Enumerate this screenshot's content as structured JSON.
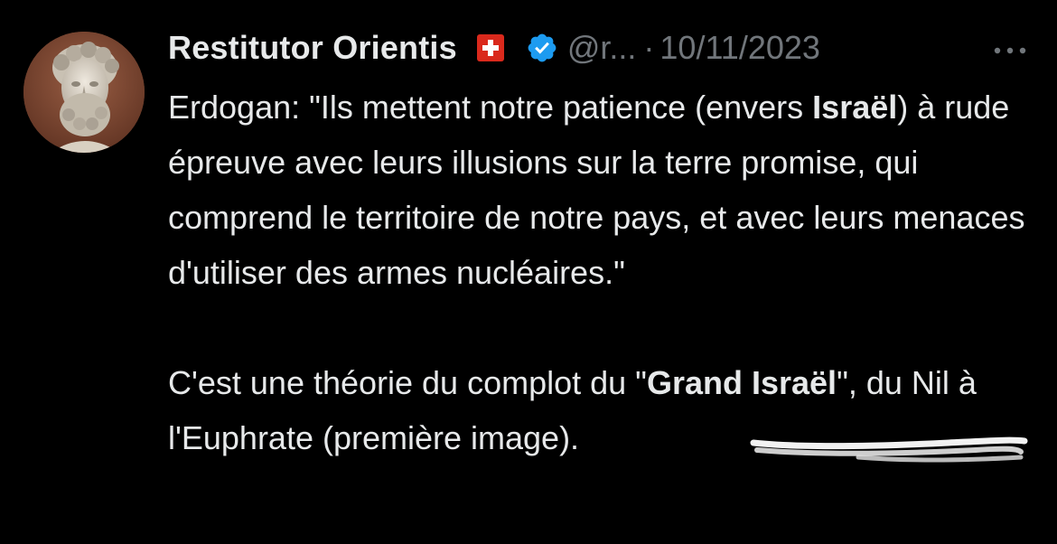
{
  "tweet": {
    "author_name": "Restitutor Orientis",
    "flag": "swiss-flag-icon",
    "verified": "verified-badge-icon",
    "handle": "@r...",
    "separator": "·",
    "date": "10/11/2023",
    "more_icon": "more-options-icon",
    "avatar": "marble-bust-avatar",
    "paragraph1": {
      "part1": "Erdogan: \"Ils mettent notre patience (envers ",
      "bold1": "Israël",
      "part2": ") à rude épreuve avec leurs illusions sur la terre promise, qui comprend le territoire de notre pays, et avec leurs menaces d'utiliser des armes nucléaires.\""
    },
    "paragraph2": {
      "part1": "C'est une théorie du complot du \"",
      "bold1": "Grand Israël",
      "part2": "\", du Nil à l'Euphrate (première image)."
    }
  },
  "colors": {
    "background": "#000000",
    "primary_text": "#e7e9ea",
    "secondary_text": "#71767b",
    "verified_blue": "#1d9bf0",
    "flag_red": "#da291c",
    "scribble": "#ffffff"
  }
}
